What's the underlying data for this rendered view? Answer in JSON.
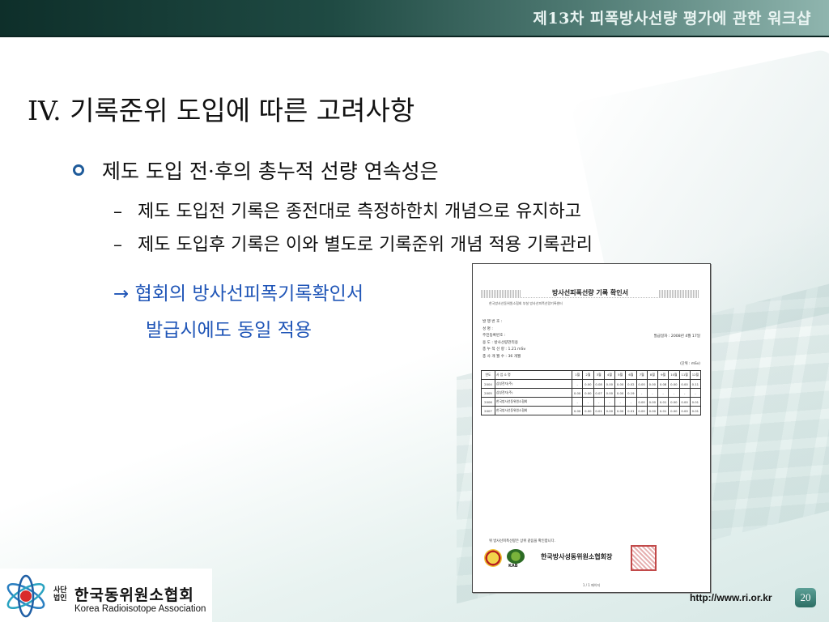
{
  "header": {
    "workshop_title": "제13차 피폭방사선량 평가에 관한 워크샵"
  },
  "slide": {
    "title": "IV. 기록준위 도입에 따른 고려사항",
    "bullet": "제도 도입 전·후의 총누적 선량 연속성은",
    "sub_items": [
      {
        "dash": "–",
        "text": "제도 도입전 기록은 종전대로 측정하한치 개념으로 유지하고"
      },
      {
        "dash": "–",
        "text": "제도 도입후 기록은 이와 별도로 기록준위 개념 적용 기록관리"
      }
    ],
    "note_line1": "→ 협회의 방사선피폭기록확인서",
    "note_line2": "발급시에도 동일 적용"
  },
  "certificate": {
    "title": "방사선피폭선량 기록 확인서",
    "subtitle": "한국방사선동위원소협회 부설 방사선피폭선량기록센터",
    "fields": [
      "발 행 번 호 :",
      "성         명 :",
      "주민등록번호 :",
      "용         도 : 방사선량관리용",
      "총 누 적 선 량 : 1.21 mSv",
      "총 사 개 월 수 : 36 개월"
    ],
    "issue_date": "발급일자 : 2008년 4월 17일",
    "unit": "(단위 : mSv)",
    "table_header": [
      "연도",
      "사 업 소 명",
      "1월",
      "2월",
      "3월",
      "4월",
      "5월",
      "6월",
      "7월",
      "8월",
      "9월",
      "10월",
      "11월",
      "12월"
    ],
    "rows": [
      [
        "2004",
        "삼성전자(주)",
        "-",
        "0.00",
        "0.08",
        "0.00",
        "0.00",
        "0.02",
        "0.00",
        "0.00",
        "0.08",
        "0.00",
        "0.00",
        "0.11"
      ],
      [
        "2005",
        "삼성전자(주)",
        "0.00",
        "0.00",
        "0.07",
        "0.00",
        "0.00",
        "0.19",
        "-",
        "-",
        "-",
        "-",
        "-",
        "-"
      ],
      [
        "2006",
        "한국방사선동위원소협회",
        "-",
        "-",
        "-",
        "-",
        "-",
        "-",
        "0.00",
        "0.00",
        "0.01",
        "0.00",
        "0.00",
        "0.01"
      ],
      [
        "2007",
        "한국방사선동위원소협회",
        "0.00",
        "0.00",
        "0.01",
        "0.00",
        "0.00",
        "0.01",
        "0.00",
        "0.00",
        "0.01",
        "0.00",
        "0.00",
        "0.01"
      ]
    ],
    "footer_note": "위 방사선피폭선량은 상위 같음을 확인합니다.",
    "seal2_label": "KAB",
    "issuer": "한국방사성동위원소협회장",
    "page": "1 / 1 페이지"
  },
  "logo": {
    "prefix": "사단법인",
    "name_kr": "한국동위원소협회",
    "name_en": "Korea Radioisotope Association"
  },
  "footer": {
    "url": "http://www.ri.or.kr",
    "page_number": "20"
  }
}
